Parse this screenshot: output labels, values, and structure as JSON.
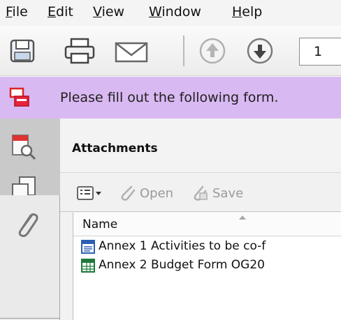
{
  "menu": {
    "file": {
      "u": "F",
      "rest": "ile"
    },
    "edit": {
      "u": "E",
      "rest": "dit"
    },
    "view": {
      "u": "V",
      "rest": "iew"
    },
    "window": {
      "u": "W",
      "rest": "indow"
    },
    "help": {
      "u": "H",
      "rest": "elp"
    }
  },
  "toolbar": {
    "page_number": "1",
    "icons": [
      "save-icon",
      "print-icon",
      "email-icon",
      "previous-page-icon",
      "next-page-icon"
    ]
  },
  "form_bar": {
    "message": "Please fill out the following form."
  },
  "attachments": {
    "title": "Attachments",
    "open_label": "Open",
    "save_label": "Save",
    "column_name": "Name",
    "items": [
      {
        "name": "Annex 1 Activities to be co-f",
        "icon": "word-document-icon",
        "color": "#2b5fb3"
      },
      {
        "name": "Annex 2 Budget Form OG20",
        "icon": "excel-document-icon",
        "color": "#1e7a3a"
      }
    ]
  },
  "colors": {
    "form_bar": "#d9b9f2",
    "rail": "#d4d4d4"
  }
}
